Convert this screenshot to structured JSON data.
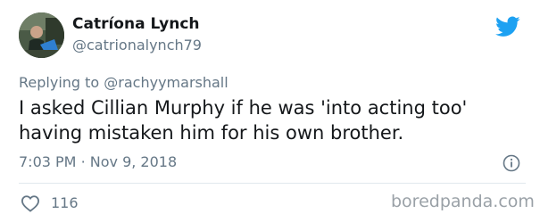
{
  "tweet": {
    "author": {
      "name": "Catríona Lynch",
      "handle": "@catrionalynch79"
    },
    "reply": {
      "prefix": "Replying to",
      "to_handle": "@rachyymarshall"
    },
    "text_lines": [
      "I asked Cillian Murphy if he was 'into acting too'",
      "having mistaken him for his own brother."
    ],
    "time": "7:03 PM",
    "separator": "·",
    "date": "Nov 9, 2018",
    "likes": "116"
  },
  "watermark": "boredpanda.com",
  "icons": {
    "bird": "twitter-bird-icon",
    "info": "info-icon",
    "like": "heart-icon"
  },
  "colors": {
    "brand_blue": "#1da1f2",
    "secondary_text": "#657786",
    "primary_text": "#14171a",
    "divider": "#e1e8ed",
    "watermark": "#9aa1a7"
  }
}
